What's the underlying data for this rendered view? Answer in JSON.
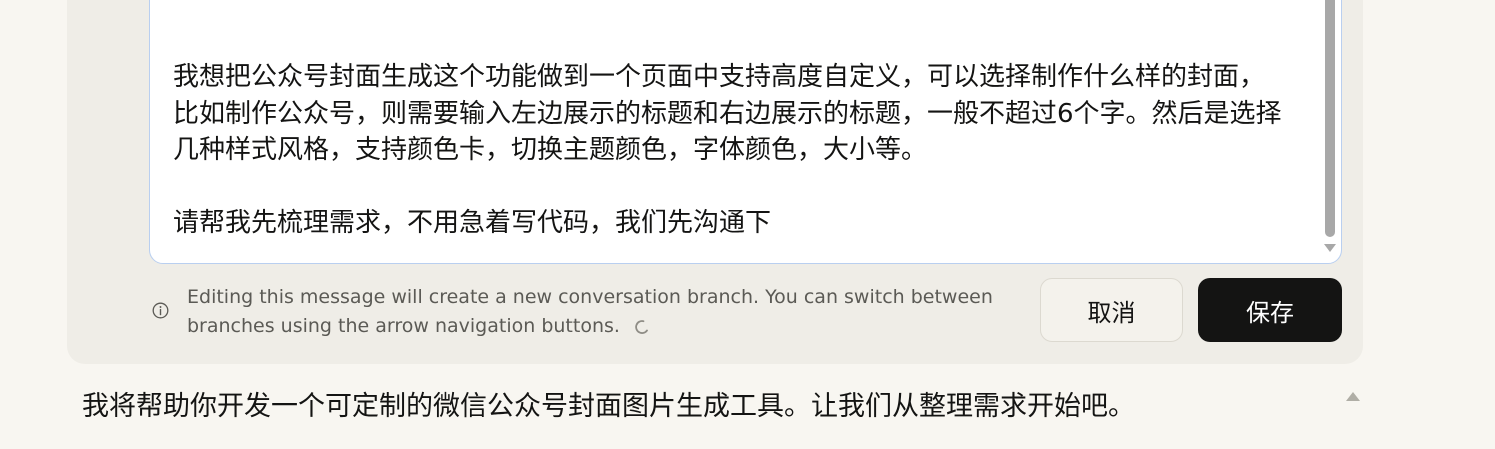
{
  "editor": {
    "content": "我想把公众号封面生成这个功能做到一个页面中支持高度自定义，可以选择制作什么样的封面，\n比如制作公众号，则需要输入左边展示的标题和右边展示的标题，一般不超过6个字。然后是选择\n几种样式风格，支持颜色卡，切换主题颜色，字体颜色，大小等。\n\n请帮我先梳理需求，不用急着写代码，我们先沟通下"
  },
  "notice": {
    "text": "Editing this message will create a new conversation branch. You can switch between branches using the arrow navigation buttons.",
    "icon": "info-icon"
  },
  "buttons": {
    "cancel_label": "取消",
    "save_label": "保存"
  },
  "assistant": {
    "response_text": "我将帮助你开发一个可定制的微信公众号封面图片生成工具。让我们从整理需求开始吧。"
  },
  "colors": {
    "background": "#f8f6f1",
    "card": "#efede7",
    "accent_border": "#b9cff0",
    "save_button": "#141413"
  }
}
